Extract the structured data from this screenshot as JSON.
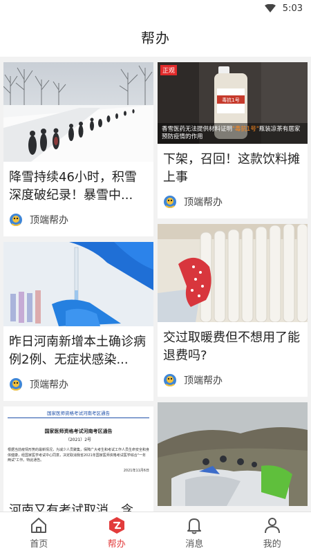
{
  "status_bar": {
    "time": "5:03"
  },
  "header": {
    "title": "帮办"
  },
  "feed": {
    "left": [
      {
        "title": "降雪持续46小时，积雪深度破纪录！暴雪中...",
        "source": "顶端帮办"
      },
      {
        "title": "昨日河南新增本土确诊病例2例、无症状感染...",
        "source": "顶端帮办"
      },
      {
        "title": "河南又有考试取消，含...",
        "doc": {
          "header_line": "国家医师资格考试河南考区通告",
          "heading": "国家医师资格考试河南考区通告",
          "subheading": "（2021）2号",
          "body": "根据当前疫情形势的最新情况，为减少人员聚集，保障广大考生和考试工作人员生命安全和身体健康，经国家医学考试中心同意，决定取消我省2021年国家医师资格考试医学综合\"一年两试\"工作。特此通告。",
          "date": "2021年11月6日"
        }
      }
    ],
    "right": [
      {
        "title": "下架，召回！这款饮料摊上事",
        "source": "顶端帮办",
        "image_badge": "正观",
        "image_caption_pre": "香雪医药无法提供材料证明",
        "image_caption_hl": "\"毒抗1号\"",
        "image_caption_post": "瓶装凉茶有居家预防疫情的作用",
        "bottle_label": "毒抗1号"
      },
      {
        "title": "交过取暖费但不想用了能退费吗?",
        "source": "顶端帮办"
      },
      {
        "title": "",
        "source": ""
      }
    ]
  },
  "tabbar": [
    {
      "label": "首页",
      "active": false
    },
    {
      "label": "帮办",
      "active": true
    },
    {
      "label": "消息",
      "active": false
    },
    {
      "label": "我的",
      "active": false
    }
  ],
  "colors": {
    "accent": "#e23c3c",
    "background": "#f2f2f2"
  }
}
